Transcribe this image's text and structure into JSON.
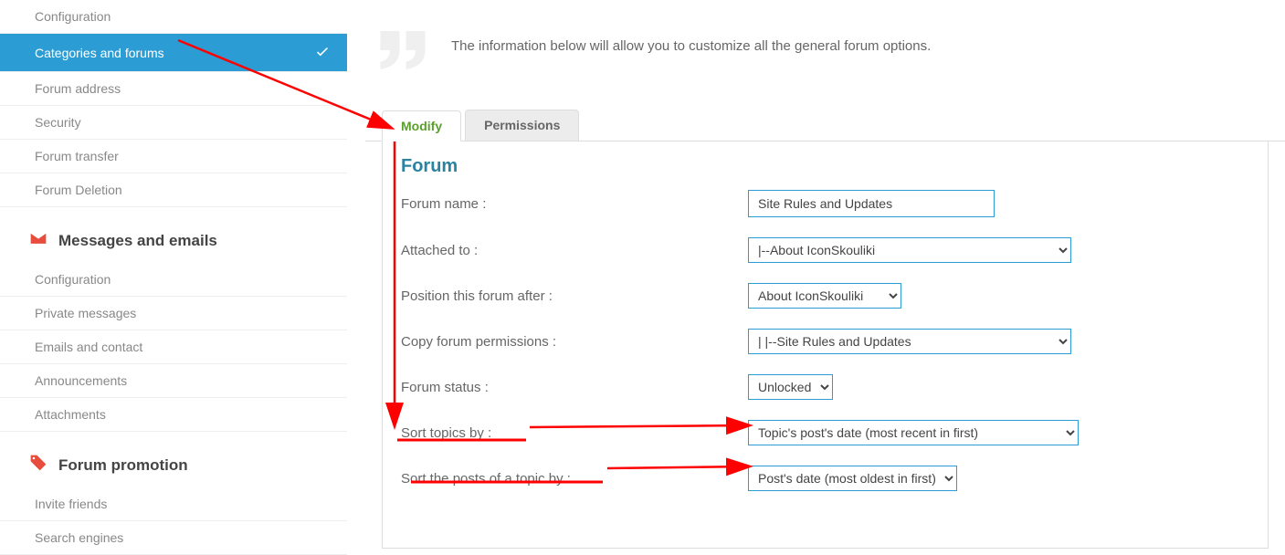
{
  "sidebar": {
    "group1": [
      "Configuration",
      "Categories and forums",
      "Forum address",
      "Security",
      "Forum transfer",
      "Forum Deletion"
    ],
    "group2_header": "Messages and emails",
    "group2": [
      "Configuration",
      "Private messages",
      "Emails and contact",
      "Announcements",
      "Attachments"
    ],
    "group3_header": "Forum promotion",
    "group3": [
      "Invite friends",
      "Search engines"
    ]
  },
  "intro": "The information below will allow you to customize all the general forum options.",
  "tabs": {
    "modify": "Modify",
    "permissions": "Permissions"
  },
  "panel": {
    "title": "Forum",
    "fields": {
      "forum_name_label": "Forum name :",
      "forum_name_value": "Site Rules and Updates",
      "attached_label": "Attached to :",
      "attached_value": "|--About IconSkouliki",
      "position_label": "Position this forum after :",
      "position_value": "About IconSkouliki",
      "copy_label": "Copy forum permissions :",
      "copy_value": "|   |--Site Rules and Updates",
      "status_label": "Forum status :",
      "status_value": "Unlocked",
      "sort_topics_label": "Sort topics by :",
      "sort_topics_value": "Topic's post's date (most recent in first)",
      "sort_posts_label": "Sort the posts of a topic by :",
      "sort_posts_value": "Post's date (most oldest in first)"
    }
  }
}
